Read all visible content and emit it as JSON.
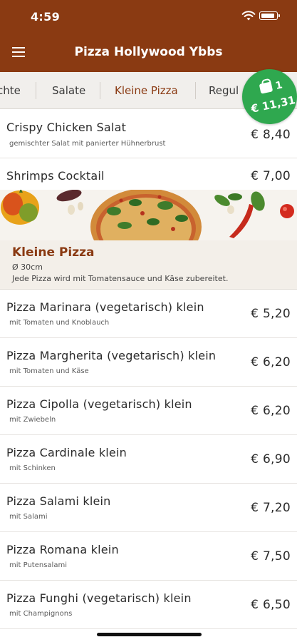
{
  "status": {
    "time": "4:59"
  },
  "header": {
    "title": "Pizza Hollywood Ybbs"
  },
  "tabs": [
    {
      "label": "chte"
    },
    {
      "label": "Salate"
    },
    {
      "label": "Kleine Pizza"
    },
    {
      "label": "Regul"
    }
  ],
  "cart": {
    "count": "1",
    "total": "€ 11,31"
  },
  "salads": [
    {
      "name": "Crispy Chicken Salat",
      "desc": "gemischter Salat mit panierter Hühnerbrust",
      "price": "€ 8,40"
    },
    {
      "name": "Shrimps Cocktail",
      "desc": "",
      "price": "€ 7,00"
    }
  ],
  "section": {
    "title": "Kleine Pizza",
    "subtitle": "Ø 30cm",
    "description": "Jede Pizza wird mit Tomatensauce und Käse zubereitet."
  },
  "pizzas": [
    {
      "name": "Pizza Marinara (vegetarisch) klein",
      "desc": "mit Tomaten und Knoblauch",
      "price": "€ 5,20"
    },
    {
      "name": "Pizza Margherita (vegetarisch) klein",
      "desc": "mit Tomaten und Käse",
      "price": "€ 6,20"
    },
    {
      "name": "Pizza Cipolla (vegetarisch) klein",
      "desc": "mit Zwiebeln",
      "price": "€ 6,20"
    },
    {
      "name": "Pizza Cardinale klein",
      "desc": "mit Schinken",
      "price": "€ 6,90"
    },
    {
      "name": "Pizza Salami klein",
      "desc": "mit Salami",
      "price": "€ 7,20"
    },
    {
      "name": "Pizza Romana klein",
      "desc": "mit Putensalami",
      "price": "€ 7,50"
    },
    {
      "name": "Pizza Funghi (vegetarisch) klein",
      "desc": "mit Champignons",
      "price": "€ 6,50"
    }
  ],
  "icons": {
    "menu": "hamburger-menu-icon",
    "cart": "shopping-bag-icon",
    "wifi": "wifi-icon",
    "battery": "battery-icon"
  },
  "colors": {
    "brand": "#8a3a12",
    "cart": "#2fa84f",
    "tabs_bg": "#f1efec"
  }
}
